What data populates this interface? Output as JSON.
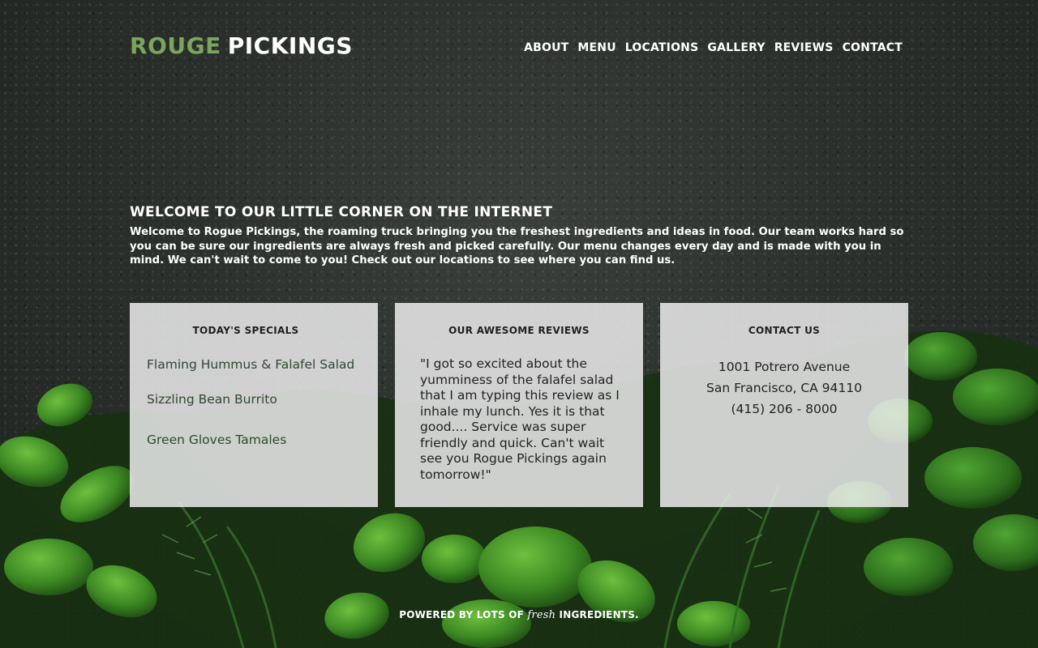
{
  "brand": {
    "part1": "ROUGE",
    "part2": "PICKINGS",
    "accent_color": "#7aa55c"
  },
  "nav": {
    "items": [
      "ABOUT",
      "MENU",
      "LOCATIONS",
      "GALLERY",
      "REVIEWS",
      "CONTACT"
    ]
  },
  "intro": {
    "heading": "WELCOME TO OUR LITTLE CORNER ON THE INTERNET",
    "body": "Welcome to Rogue Pickings, the roaming truck bringing you the freshest ingredients and ideas in food. Our team works hard so you can be sure our ingredients are always fresh and picked carefully. Our menu changes every day and is made with you in mind. We can't wait to come to you! Check out our locations to see where you can find us."
  },
  "specials": {
    "title": "TODAY'S SPECIALS",
    "items": [
      "Flaming Hummus & Falafel Salad",
      "Sizzling Bean Burrito",
      "Green Gloves Tamales"
    ]
  },
  "reviews": {
    "title": "OUR AWESOME REVIEWS",
    "text": "\"I got so excited about the yumminess of the falafel salad that I am typing this review as I inhale my lunch. Yes it is that good.... Service was super friendly and quick. Can't wait see you Rogue Pickings again tomorrow!\""
  },
  "contact": {
    "title": "CONTACT US",
    "street": "1001 Potrero Avenue",
    "city": "San Francisco, CA 94110",
    "phone": "(415) 206 - 8000"
  },
  "footer": {
    "prefix": "POWERED BY LOTS OF",
    "fresh": "fresh",
    "suffix": "INGREDIENTS."
  }
}
